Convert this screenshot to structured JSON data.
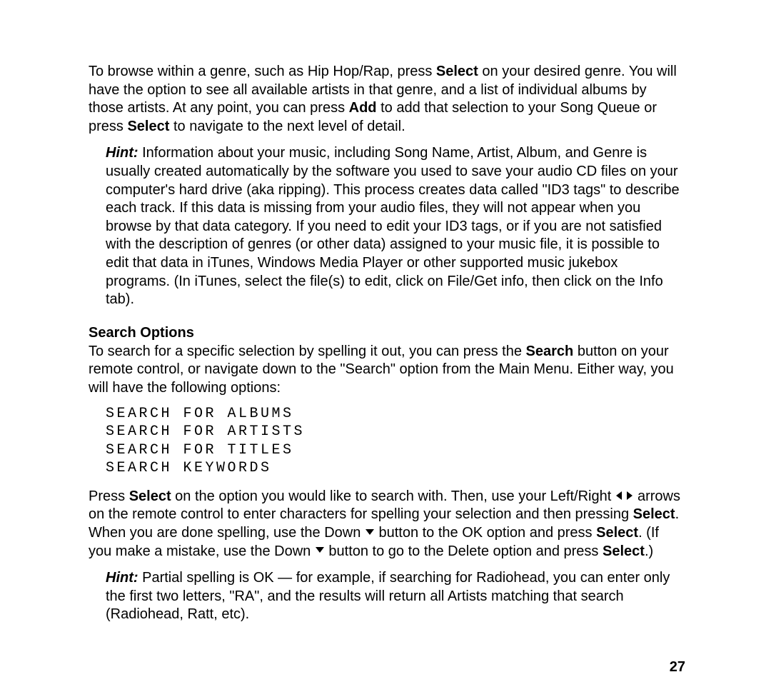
{
  "p1": {
    "a": "To browse within a genre, such as Hip Hop/Rap, press ",
    "b": "Select",
    "c": " on your desired genre. You will have the option to see all available artists in that genre, and a list of individual albums by those artists. At any point, you can press ",
    "d": "Add",
    "e": " to add that selection to your Song Queue or press ",
    "f": "Select",
    "g": " to navigate to the next level of detail."
  },
  "hint1": {
    "label": "Hint:",
    "text": " Information about your music, including Song Name, Artist, Album, and Genre is usually created automatically by the software you used to save your audio CD files on your computer's hard drive (aka ripping). This process creates data called \"ID3 tags\" to describe each track.  If this data is missing from your audio files, they will not appear when you browse by that data category. If you need to edit your ID3 tags, or if you are not satisfied with the description of genres (or other data) assigned to your music file, it is possible to edit that data in iTunes, Windows Media Player or other supported music jukebox programs. (In iTunes, select the file(s) to edit, click on File/Get info, then click on the Info tab)."
  },
  "heading1": "Search Options",
  "p2": {
    "a": "To search for a specific selection by spelling it out, you can press the ",
    "b": "Search",
    "c": " button on your remote control, or navigate down to the \"Search\" option from the Main Menu. Either way, you will have the following options:"
  },
  "menu": {
    "i1": "Search for Albums",
    "i2": "Search for Artists",
    "i3": "Search for Titles",
    "i4": "Search Keywords"
  },
  "p3": {
    "a": "Press ",
    "b": "Select",
    "c": " on the option you would like to search with. Then, use your Left/Right ",
    "d": " arrows on the remote control to enter characters for spelling your selection and then pressing ",
    "e": "Select",
    "f": ". When you are done spelling, use the Down ",
    "g": " button to the OK option and press ",
    "h": "Select",
    "i": ". (If you make a mistake, use the Down ",
    "j": " button to go to the Delete option and press ",
    "k": "Select",
    "l": ".)"
  },
  "hint2": {
    "label": "Hint:",
    "text": " Partial spelling is OK — for example, if searching for Radiohead, you can enter only the first two letters, \"RA\", and the results will return all Artists matching that search (Radiohead, Ratt, etc)."
  },
  "pageNumber": "27"
}
